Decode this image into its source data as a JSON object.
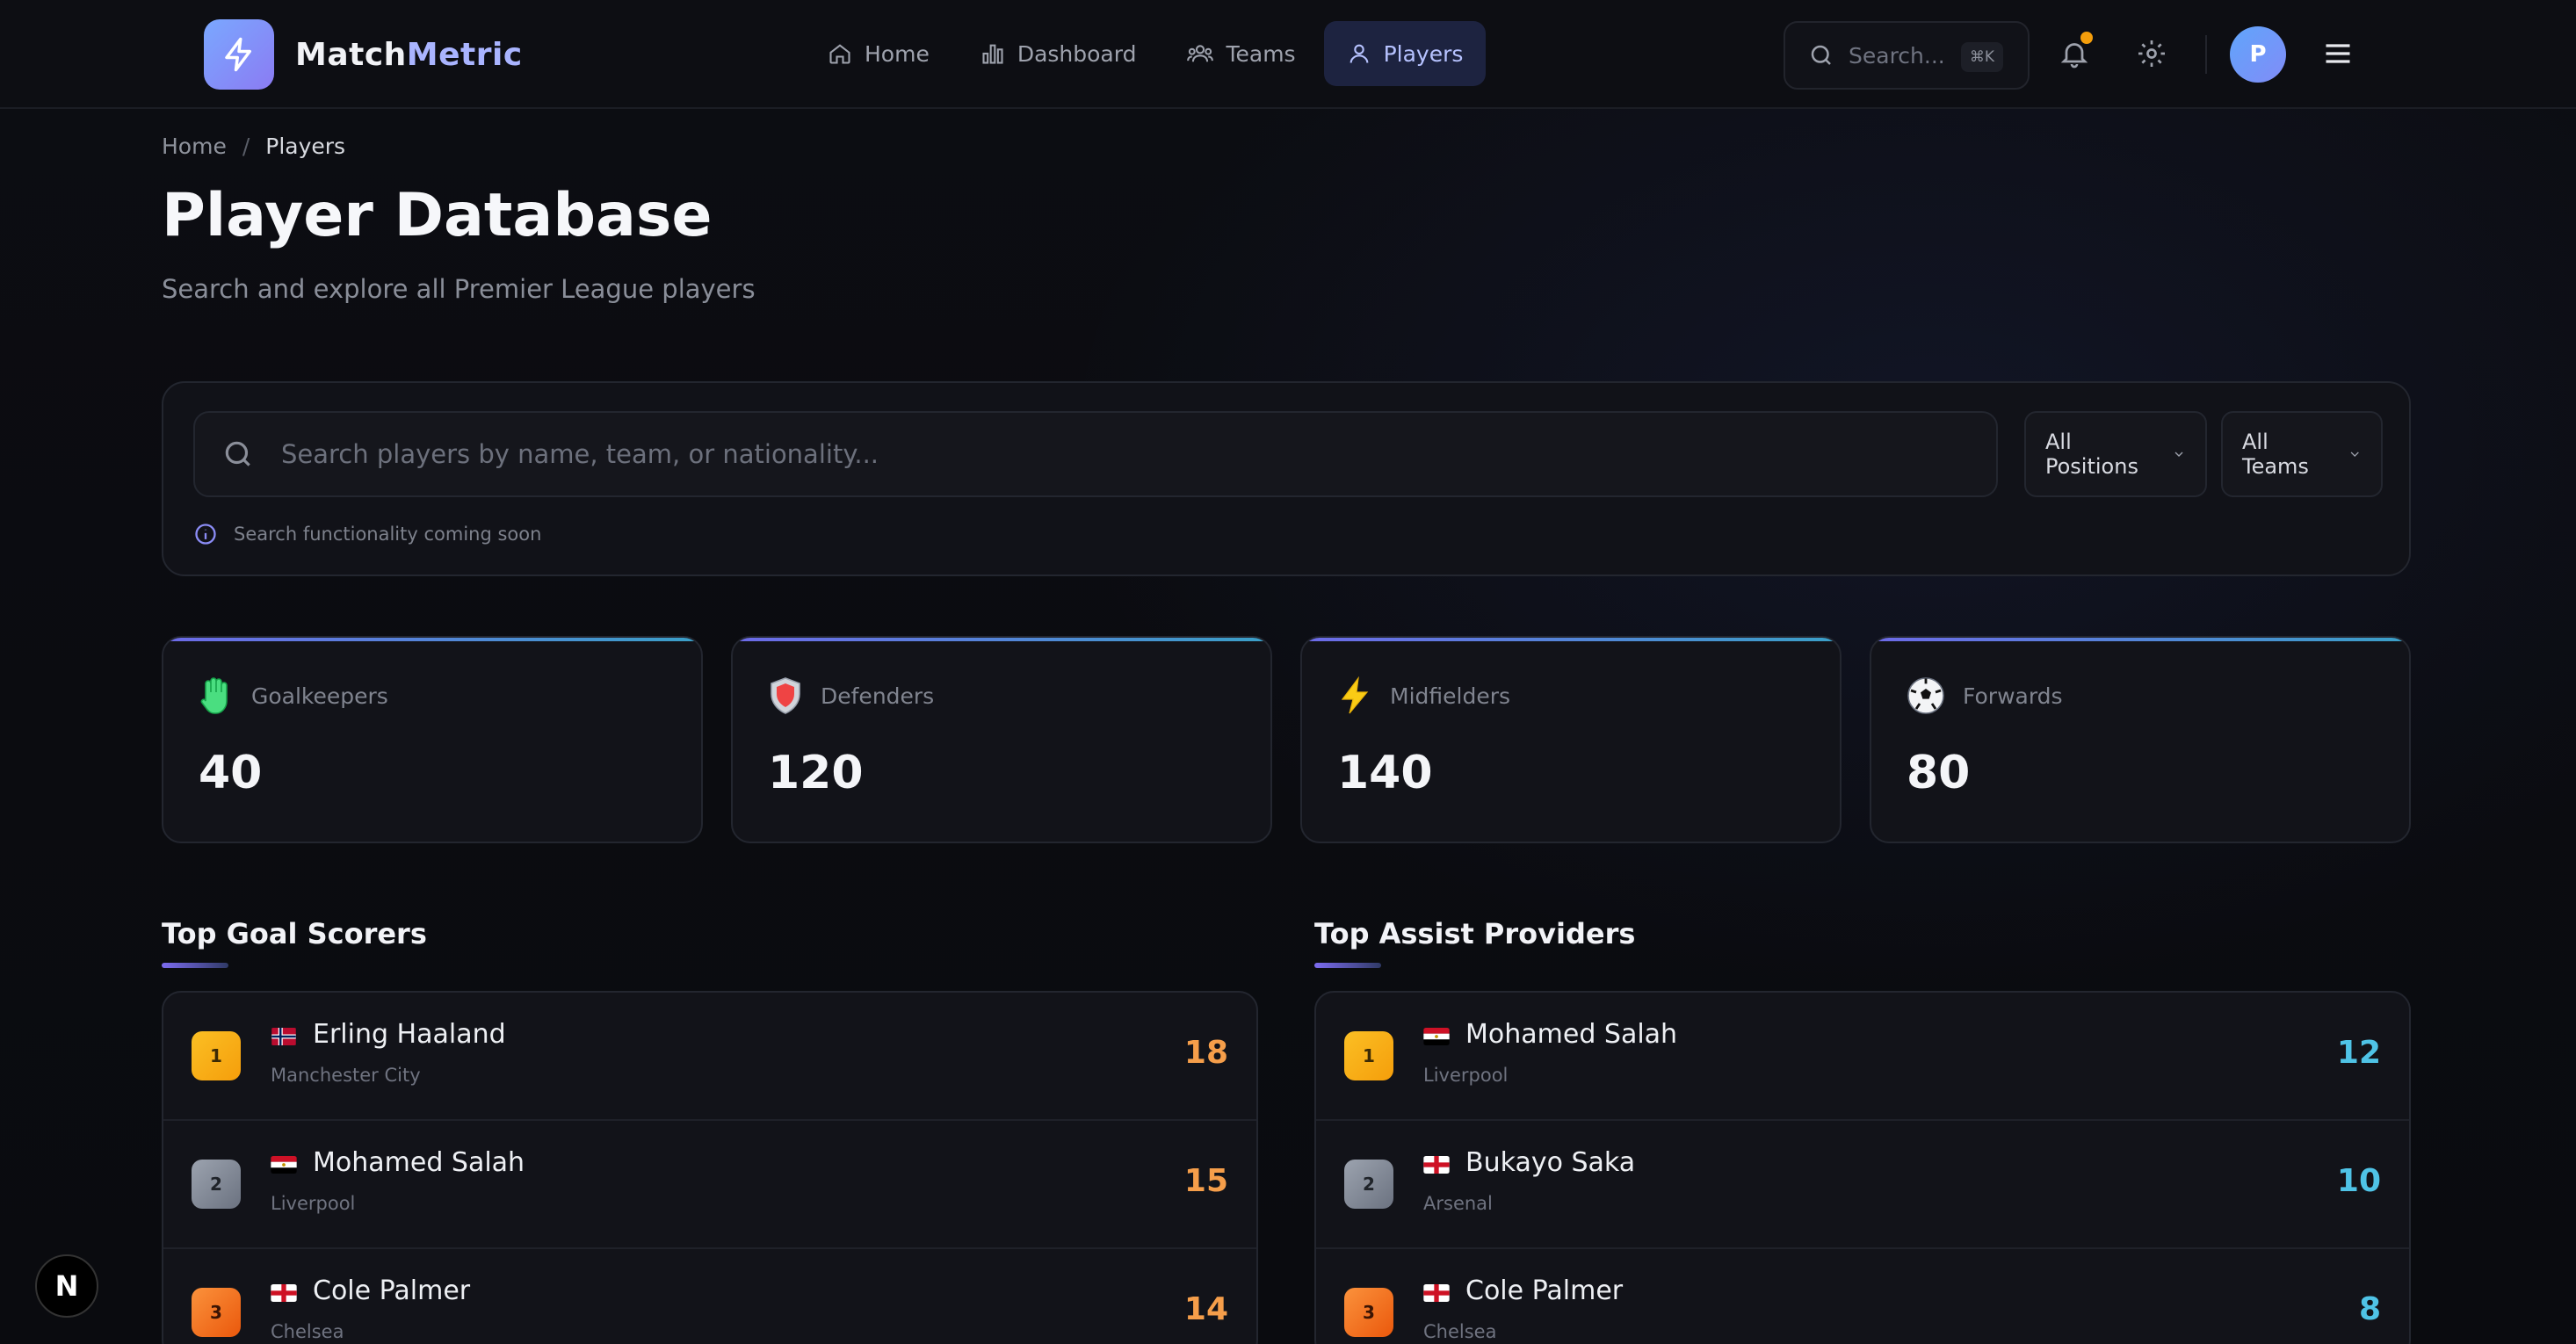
{
  "brand": {
    "name_part1": "Match",
    "name_part2": "Metric"
  },
  "nav": {
    "items": [
      {
        "label": "Home"
      },
      {
        "label": "Dashboard"
      },
      {
        "label": "Teams"
      },
      {
        "label": "Players"
      }
    ],
    "active": "Players"
  },
  "header_search": {
    "placeholder": "Search...",
    "shortcut": "⌘K"
  },
  "user": {
    "initial": "P"
  },
  "breadcrumb": {
    "home": "Home",
    "separator": "/",
    "current": "Players"
  },
  "page": {
    "title": "Player Database",
    "subtitle": "Search and explore all Premier League players"
  },
  "search": {
    "placeholder": "Search players by name, team, or nationality...",
    "positions_filter": "All Positions",
    "teams_filter": "All Teams",
    "hint": "Search functionality coming soon"
  },
  "stats": [
    {
      "label": "Goalkeepers",
      "value": "40",
      "icon": "glove-icon"
    },
    {
      "label": "Defenders",
      "value": "120",
      "icon": "shield-icon"
    },
    {
      "label": "Midfielders",
      "value": "140",
      "icon": "lightning-icon"
    },
    {
      "label": "Forwards",
      "value": "80",
      "icon": "soccer-ball-icon"
    }
  ],
  "top_scorers": {
    "title": "Top Goal Scorers",
    "rows": [
      {
        "rank": "1",
        "name": "Erling Haaland",
        "team": "Manchester City",
        "value": "18",
        "flag": "norway"
      },
      {
        "rank": "2",
        "name": "Mohamed Salah",
        "team": "Liverpool",
        "value": "15",
        "flag": "egypt"
      },
      {
        "rank": "3",
        "name": "Cole Palmer",
        "team": "Chelsea",
        "value": "14",
        "flag": "england"
      }
    ]
  },
  "top_assists": {
    "title": "Top Assist Providers",
    "rows": [
      {
        "rank": "1",
        "name": "Mohamed Salah",
        "team": "Liverpool",
        "value": "12",
        "flag": "egypt"
      },
      {
        "rank": "2",
        "name": "Bukayo Saka",
        "team": "Arsenal",
        "value": "10",
        "flag": "england"
      },
      {
        "rank": "3",
        "name": "Cole Palmer",
        "team": "Chelsea",
        "value": "8",
        "flag": "england"
      }
    ]
  },
  "next_badge": {
    "label": "N"
  },
  "colors": {
    "accent": "#b6c2ff",
    "goals": "#f59e4a",
    "assists": "#4fc3e6"
  }
}
